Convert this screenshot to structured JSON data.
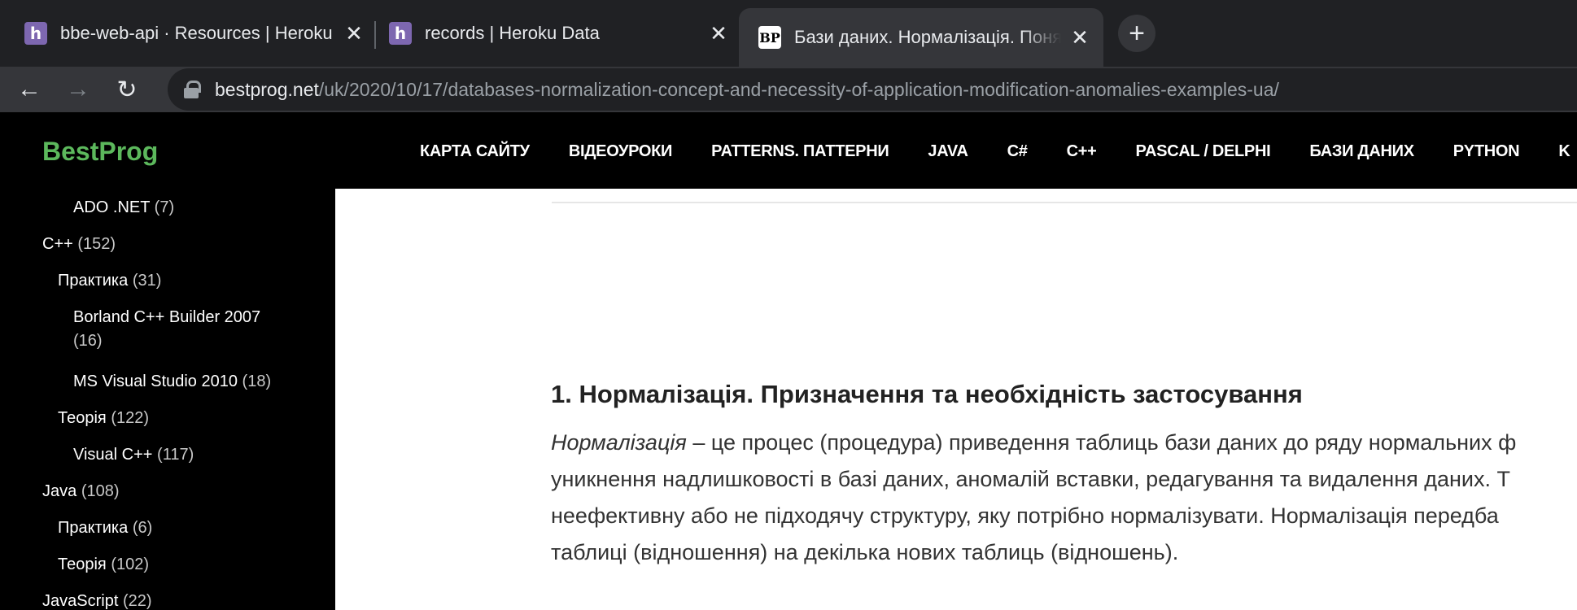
{
  "browser": {
    "tabs": [
      {
        "title": "bbe-web-api · Resources | Heroku",
        "icon": "heroku-icon"
      },
      {
        "title": "records | Heroku Data",
        "icon": "heroku-icon"
      },
      {
        "title": "Бази даних. Нормалізація. Поня",
        "icon": "bestprog-icon"
      }
    ],
    "close_glyph": "✕",
    "new_tab_glyph": "+",
    "back_glyph": "←",
    "forward_glyph": "→",
    "reload_glyph": "↻",
    "url_host": "bestprog.net",
    "url_path": "/uk/2020/10/17/databases-normalization-concept-and-necessity-of-application-modification-anomalies-examples-ua/"
  },
  "site": {
    "logo": "BestProg",
    "nav": [
      "КАРТА САЙТУ",
      "ВІДЕОУРОКИ",
      "PATTERNS. ПАТТЕРНИ",
      "JAVA",
      "C#",
      "C++",
      "PASCAL / DELPHI",
      "БАЗИ ДАНИХ",
      "PYTHON",
      "K"
    ]
  },
  "sidebar": {
    "items": [
      {
        "label": "ADO .NET",
        "count": "(7)"
      },
      {
        "label": "C++",
        "count": "(152)"
      },
      {
        "label": "Практика",
        "count": "(31)"
      },
      {
        "label": "Borland C++ Builder 2007",
        "count": "(16)"
      },
      {
        "label": "MS Visual Studio 2010",
        "count": "(18)"
      },
      {
        "label": "Теорія",
        "count": "(122)"
      },
      {
        "label": "Visual C++",
        "count": "(117)"
      },
      {
        "label": "Java",
        "count": "(108)"
      },
      {
        "label": "Практика",
        "count": "(6)"
      },
      {
        "label": "Теорія",
        "count": "(102)"
      },
      {
        "label": "JavaScript",
        "count": "(22)"
      }
    ]
  },
  "article": {
    "heading": "1. Нормалізація. Призначення та необхідність застосування",
    "term": "Нормалізація",
    "lines": [
      " – це процес (процедура) приведення таблиць бази даних до ряду нормальних ф",
      "уникнення надлишковості в базі даних, аномалій вставки, редагування та видалення даних. Т",
      "неефективну або не підходячу структуру, яку потрібно нормалізувати. Нормалізація передба",
      "таблиці (відношення) на декілька нових таблиць (відношень)."
    ]
  },
  "colors": {
    "tabstrip_bg": "#202124",
    "active_tab_bg": "#35363a",
    "logo_green": "#5cb85c",
    "heroku_purple": "#7d67b0"
  }
}
